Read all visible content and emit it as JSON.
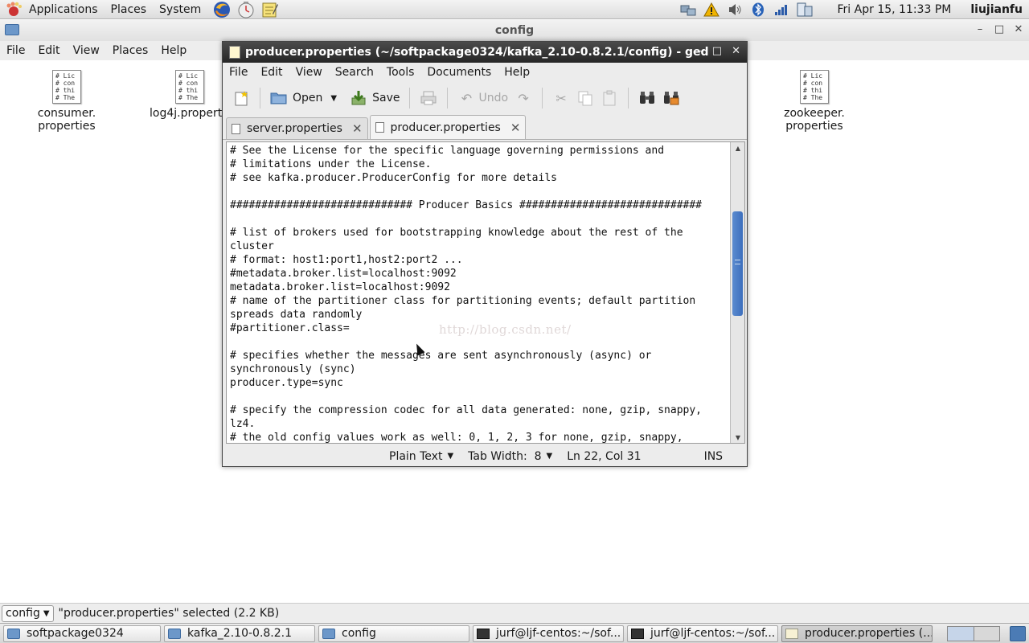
{
  "top_panel": {
    "menus": [
      "Applications",
      "Places",
      "System"
    ],
    "clock": "Fri Apr 15, 11:33 PM",
    "user": "liujianfu",
    "launchers": [
      "firefox-icon",
      "clock-icon",
      "notes-icon"
    ],
    "tray": [
      "network-icon",
      "warning-icon",
      "volume-icon",
      "bluetooth-icon",
      "signal-icon",
      "monitor-icon"
    ]
  },
  "nautilus": {
    "title": "config",
    "menu": [
      "File",
      "Edit",
      "View",
      "Places",
      "Help"
    ],
    "files": [
      {
        "line1": "consumer.",
        "line2": "properties"
      },
      {
        "line1": "log4j.properti",
        "line2": ""
      },
      {
        "line1": "zookeeper.",
        "line2": "properties"
      }
    ],
    "thumb_lines": [
      "# Lic",
      "# con",
      "# thi",
      "# The"
    ],
    "path_combo": "config",
    "status": "\"producer.properties\" selected (2.2 KB)"
  },
  "gedit": {
    "title": "producer.properties (~/softpackage0324/kafka_2.10-0.8.2.1/config) - ged",
    "menu": [
      "File",
      "Edit",
      "View",
      "Search",
      "Tools",
      "Documents",
      "Help"
    ],
    "toolbar": {
      "open": "Open",
      "save": "Save",
      "undo": "Undo"
    },
    "tabs": [
      "server.properties",
      "producer.properties"
    ],
    "lines": [
      "# See the License for the specific language governing permissions and",
      "# limitations under the License.",
      "# see kafka.producer.ProducerConfig for more details",
      "",
      "############################# Producer Basics #############################",
      "",
      "# list of brokers used for bootstrapping knowledge about the rest of the",
      "cluster",
      "# format: host1:port1,host2:port2 ...",
      "#metadata.broker.list=localhost:9092",
      "metadata.broker.list=localhost:9092",
      "# name of the partitioner class for partitioning events; default partition",
      "spreads data randomly",
      "#partitioner.class=",
      "",
      "# specifies whether the messages are sent asynchronously (async) or",
      "synchronously (sync)",
      "producer.type=sync",
      "",
      "# specify the compression codec for all data generated: none, gzip, snappy,",
      "lz4.",
      "# the old config values work as well: 0, 1, 2, 3 for none, gzip, snappy,"
    ],
    "watermark": "http://blog.csdn.net/",
    "status": {
      "language": "Plain Text",
      "tab_width": "Tab Width:  8",
      "position": "Ln 22, Col 31",
      "mode": "INS"
    }
  },
  "taskbar": [
    {
      "label": "softpackage0324",
      "kind": "folder"
    },
    {
      "label": "kafka_2.10-0.8.2.1",
      "kind": "folder"
    },
    {
      "label": "config",
      "kind": "folder"
    },
    {
      "label": "jurf@ljf-centos:~/sof...",
      "kind": "term"
    },
    {
      "label": "jurf@ljf-centos:~/sof...",
      "kind": "term"
    },
    {
      "label": "producer.properties (...",
      "kind": "edit",
      "active": true
    }
  ],
  "colors": {
    "accent": "#3d6fbd",
    "titlebar": "#2f2f2f",
    "panel": "#e0e0e0"
  }
}
